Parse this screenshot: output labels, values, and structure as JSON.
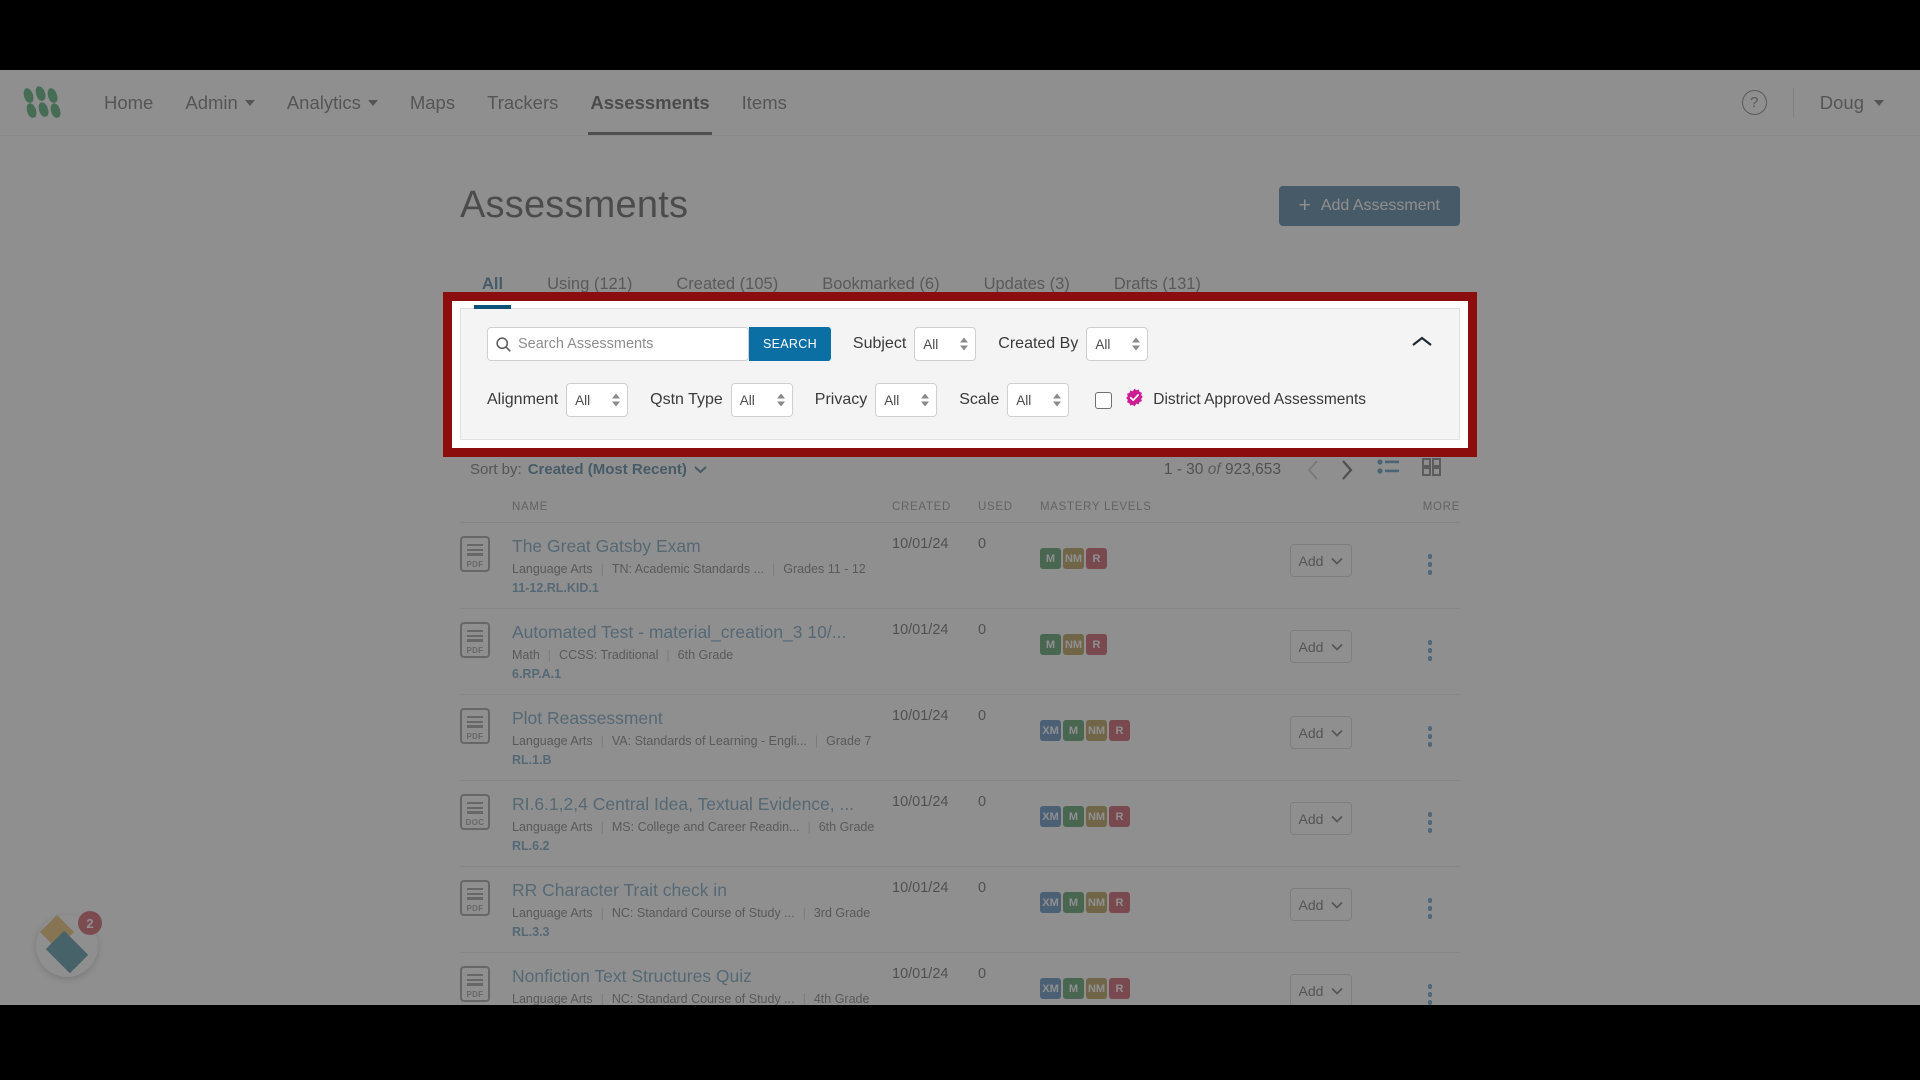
{
  "nav": {
    "logo_name": "app-logo",
    "items": [
      {
        "label": "Home",
        "has_caret": false,
        "active": false
      },
      {
        "label": "Admin",
        "has_caret": true,
        "active": false
      },
      {
        "label": "Analytics",
        "has_caret": true,
        "active": false
      },
      {
        "label": "Maps",
        "has_caret": false,
        "active": false
      },
      {
        "label": "Trackers",
        "has_caret": false,
        "active": false
      },
      {
        "label": "Assessments",
        "has_caret": false,
        "active": true
      },
      {
        "label": "Items",
        "has_caret": false,
        "active": false
      }
    ],
    "help_label": "?",
    "user_label": "Doug"
  },
  "header": {
    "title": "Assessments",
    "add_button": "Add Assessment",
    "add_button_plus": "+",
    "add_button_color": "#0c5178"
  },
  "tabs": [
    {
      "label": "All",
      "active": true
    },
    {
      "label": "Using (121)",
      "active": false
    },
    {
      "label": "Created (105)",
      "active": false
    },
    {
      "label": "Bookmarked (6)",
      "active": false
    },
    {
      "label": "Updates (3)",
      "active": false
    },
    {
      "label": "Drafts (131)",
      "active": false
    }
  ],
  "filters": {
    "search_placeholder": "Search Assessments",
    "search_value": "",
    "search_button": "SEARCH",
    "search_button_color": "#0b6fa4",
    "row1": [
      {
        "label": "Subject",
        "value": "All"
      },
      {
        "label": "Created By",
        "value": "All"
      }
    ],
    "row2": [
      {
        "label": "Alignment",
        "value": "All"
      },
      {
        "label": "Qstn Type",
        "value": "All"
      },
      {
        "label": "Privacy",
        "value": "All"
      },
      {
        "label": "Scale",
        "value": "All"
      }
    ],
    "district_approved_label": "District Approved Assessments",
    "district_approved_checked": false,
    "district_badge_color": "#cc1c95",
    "collapse_icon": "chevron-up"
  },
  "sort": {
    "label": "Sort by:",
    "value": "Created (Most Recent)"
  },
  "pagination": {
    "range": "1 - 30",
    "of": "of",
    "total": "923,653",
    "prev_icon": "chevron-left",
    "next_icon": "chevron-right",
    "list_view_active": true,
    "grid_view_active": false
  },
  "table": {
    "columns": [
      "NAME",
      "CREATED",
      "USED",
      "MASTERY LEVELS",
      "MORE"
    ],
    "add_label": "Add",
    "rows": [
      {
        "file_type": "PDF",
        "title": "The Great Gatsby Exam",
        "subject": "Language Arts",
        "standard": "TN: Academic Standards ...",
        "grade": "Grades 11 - 12",
        "code": "11-12.RL.KID.1",
        "created": "10/01/24",
        "used": "0",
        "mastery": [
          "M",
          "NM",
          "R"
        ]
      },
      {
        "file_type": "PDF",
        "title": "Automated Test - material_creation_3 10/...",
        "subject": "Math",
        "standard": "CCSS: Traditional",
        "grade": "6th Grade",
        "code": "6.RP.A.1",
        "created": "10/01/24",
        "used": "0",
        "mastery": [
          "M",
          "NM",
          "R"
        ]
      },
      {
        "file_type": "PDF",
        "title": "Plot Reassessment",
        "subject": "Language Arts",
        "standard": "VA: Standards of Learning - Engli...",
        "grade": "Grade 7",
        "code": "RL.1.B",
        "created": "10/01/24",
        "used": "0",
        "mastery": [
          "XM",
          "M",
          "NM",
          "R"
        ]
      },
      {
        "file_type": "DOC",
        "title": "RI.6.1,2,4 Central Idea, Textual Evidence, ...",
        "subject": "Language Arts",
        "standard": "MS: College and Career Readin...",
        "grade": "6th Grade",
        "code": "RL.6.2",
        "created": "10/01/24",
        "used": "0",
        "mastery": [
          "XM",
          "M",
          "NM",
          "R"
        ]
      },
      {
        "file_type": "PDF",
        "title": "RR Character Trait check in",
        "subject": "Language Arts",
        "standard": "NC: Standard Course of Study ...",
        "grade": "3rd Grade",
        "code": "RL.3.3",
        "created": "10/01/24",
        "used": "0",
        "mastery": [
          "XM",
          "M",
          "NM",
          "R"
        ]
      },
      {
        "file_type": "PDF",
        "title": "Nonfiction Text Structures Quiz",
        "subject": "Language Arts",
        "standard": "NC: Standard Course of Study ...",
        "grade": "4th Grade",
        "code": "",
        "created": "10/01/24",
        "used": "0",
        "mastery": [
          "XM",
          "M",
          "NM",
          "R"
        ]
      }
    ]
  },
  "chat_widget": {
    "badge_count": "2"
  },
  "highlight": {
    "color": "#8c0d0d"
  }
}
